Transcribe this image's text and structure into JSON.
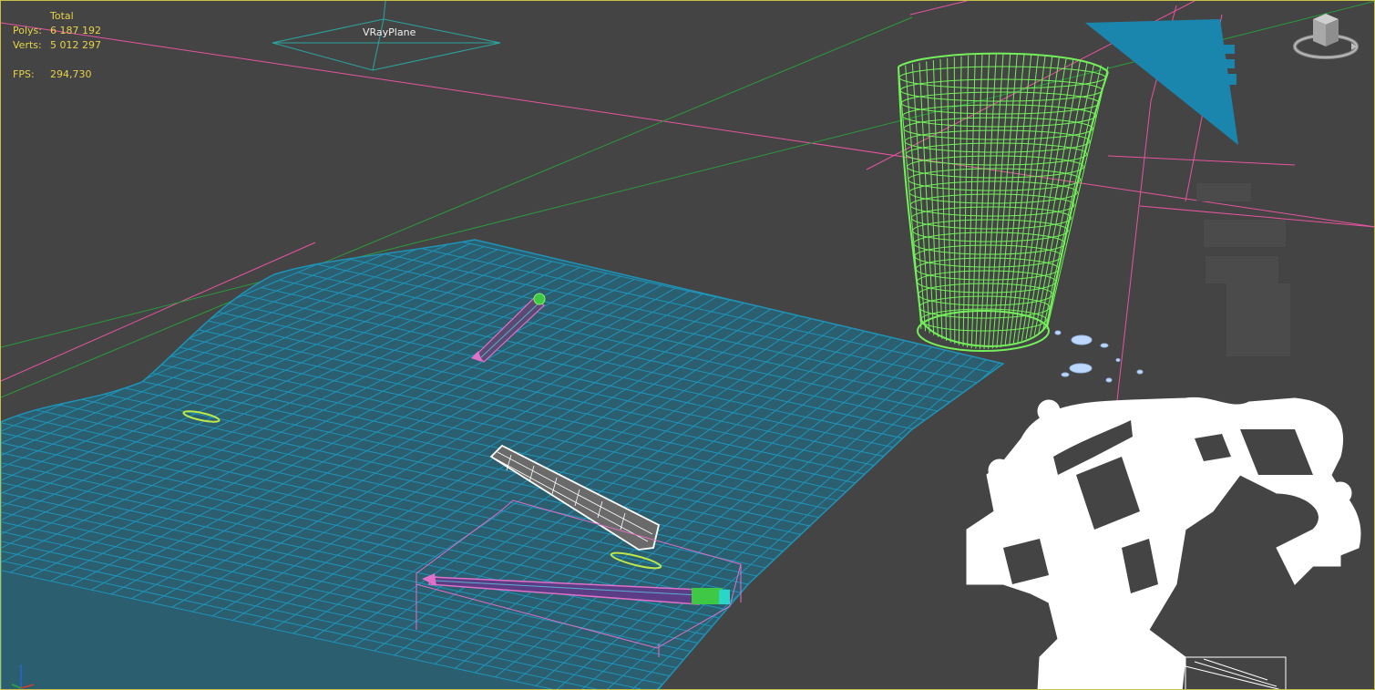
{
  "viewport": {
    "stats": {
      "header": "Total",
      "polys_label": "Polys:",
      "polys_value": "6 187 192",
      "verts_label": "Verts:",
      "verts_value": "5 012 297",
      "fps_label": "FPS:",
      "fps_value": "294,730"
    },
    "object_label": "VRayPlane",
    "viewcube_icon": "viewcube-icon",
    "axis_icon": "axis-tripod-icon"
  },
  "colors": {
    "background": "#444444",
    "border": "#c9c04a",
    "stats_text": "#e6d24a",
    "cloth_wire": "#1f93b8",
    "glass_wire": "#73f05a",
    "pencil_pink": "#e070c8",
    "pencil_green": "#3ec846",
    "guide_pink": "#e6559e",
    "guide_green": "#2b9a3e",
    "white_mesh": "#ffffff",
    "blue_panel": "#1a86ad",
    "drop_blue": "#bcd8ff"
  }
}
